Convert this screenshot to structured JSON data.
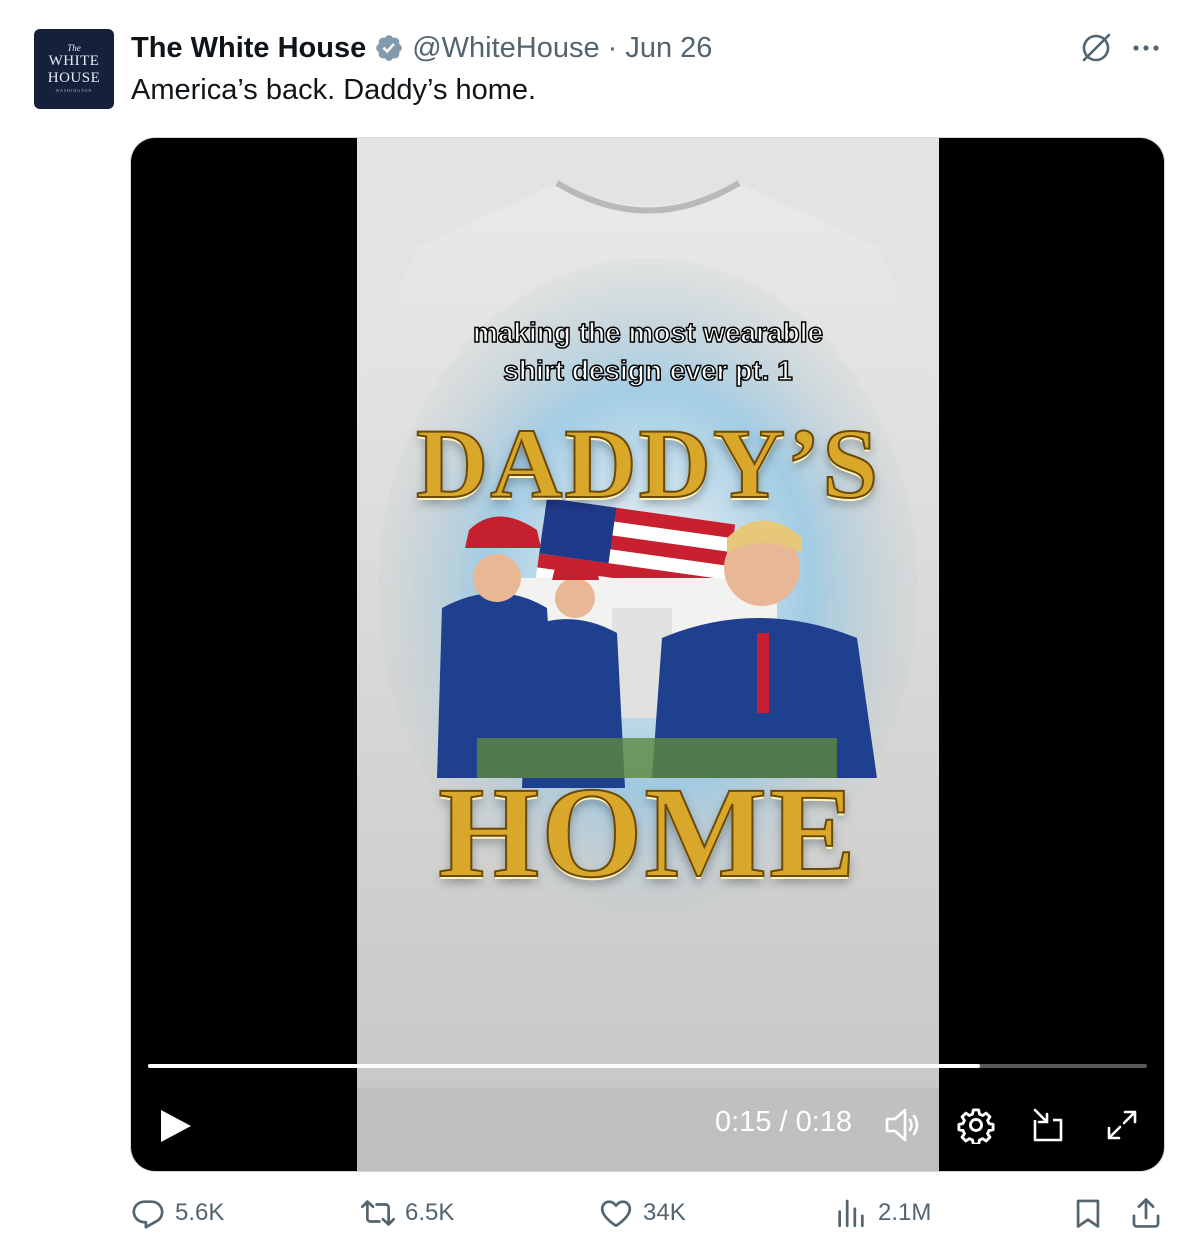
{
  "tweet": {
    "avatar": {
      "line1": "The",
      "line2": "WHITE",
      "line3": "HOUSE",
      "line4": "WASHINGTON"
    },
    "display_name": "The White House",
    "handle": "@WhiteHouse",
    "separator": "·",
    "date": "Jun 26",
    "text": "America’s back. Daddy’s home."
  },
  "video": {
    "overlay_caption_line1": "making the most wearable",
    "overlay_caption_line2": "shirt design ever pt. 1",
    "design_title_top": "DADDY’S",
    "design_title_bottom": "HOME",
    "time": "0:15 / 0:18",
    "progress_fraction": 0.833
  },
  "actions": {
    "replies": "5.6K",
    "reposts": "6.5K",
    "likes": "34K",
    "views": "2.1M"
  },
  "colors": {
    "secondary_text": "#536471",
    "primary_text": "#0f1419",
    "verified_blue": "#1d9bf0",
    "video_bg": "#000000"
  },
  "icons": [
    "grok-icon",
    "more-icon",
    "verified-badge-icon",
    "play-icon",
    "volume-icon",
    "settings-icon",
    "pip-icon",
    "fullscreen-icon",
    "reply-icon",
    "retweet-icon",
    "like-icon",
    "views-icon",
    "bookmark-icon",
    "share-icon"
  ]
}
